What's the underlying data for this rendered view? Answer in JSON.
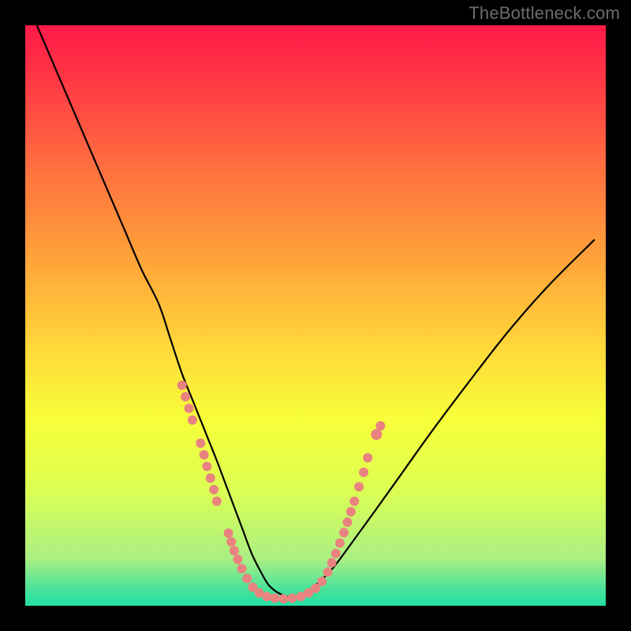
{
  "watermark": "TheBottleneck.com",
  "colors": {
    "curve": "#000000",
    "marker_fill": "#e9837f",
    "marker_stroke": "#e9837f"
  },
  "chart_data": {
    "type": "line",
    "title": "",
    "xlabel": "",
    "ylabel": "",
    "xlim": [
      0,
      100
    ],
    "ylim": [
      0,
      100
    ],
    "grid": false,
    "note": "No axis ticks or numeric labels are rendered; x and y values are estimated fractions (0–100) of the visible plot box. y runs bottom (0) to top (100).",
    "series": [
      {
        "name": "bottleneck-curve",
        "x": [
          2,
          5,
          8,
          11,
          14,
          17,
          20,
          23,
          25,
          27,
          29,
          31,
          33,
          34.5,
          36,
          37.5,
          39,
          40.5,
          42,
          44,
          46,
          48,
          50,
          53,
          56,
          60,
          65,
          70,
          76,
          83,
          90,
          98
        ],
        "y": [
          100,
          93,
          86,
          79,
          72,
          65,
          58,
          52,
          46,
          40,
          35,
          30,
          25,
          21,
          17,
          13,
          9,
          6,
          3.5,
          2,
          1.5,
          2,
          3.5,
          6.5,
          10.5,
          16,
          23,
          30,
          38,
          47,
          55,
          63
        ]
      }
    ],
    "markers": {
      "name": "curve-markers",
      "note": "Coral dot clusters on the curve in the lower region; sizes in pixels.",
      "points": [
        {
          "x": 27.0,
          "y": 38.0,
          "r": 6
        },
        {
          "x": 27.6,
          "y": 36.0,
          "r": 6
        },
        {
          "x": 28.2,
          "y": 34.0,
          "r": 6
        },
        {
          "x": 28.8,
          "y": 32.0,
          "r": 6
        },
        {
          "x": 30.2,
          "y": 28.0,
          "r": 6
        },
        {
          "x": 30.8,
          "y": 26.0,
          "r": 6
        },
        {
          "x": 31.3,
          "y": 24.0,
          "r": 6
        },
        {
          "x": 31.9,
          "y": 22.0,
          "r": 6
        },
        {
          "x": 32.5,
          "y": 20.0,
          "r": 6
        },
        {
          "x": 33.0,
          "y": 18.0,
          "r": 6
        },
        {
          "x": 35.0,
          "y": 12.5,
          "r": 6
        },
        {
          "x": 35.5,
          "y": 11.0,
          "r": 6
        },
        {
          "x": 36.0,
          "y": 9.5,
          "r": 6
        },
        {
          "x": 36.6,
          "y": 8.0,
          "r": 6
        },
        {
          "x": 37.3,
          "y": 6.4,
          "r": 6
        },
        {
          "x": 38.2,
          "y": 4.7,
          "r": 6
        },
        {
          "x": 39.2,
          "y": 3.2,
          "r": 6
        },
        {
          "x": 40.3,
          "y": 2.2,
          "r": 6
        },
        {
          "x": 41.6,
          "y": 1.6,
          "r": 6
        },
        {
          "x": 43.0,
          "y": 1.3,
          "r": 6
        },
        {
          "x": 44.5,
          "y": 1.2,
          "r": 6
        },
        {
          "x": 46.0,
          "y": 1.3,
          "r": 6
        },
        {
          "x": 47.5,
          "y": 1.6,
          "r": 6
        },
        {
          "x": 48.8,
          "y": 2.2,
          "r": 6
        },
        {
          "x": 50.0,
          "y": 3.0,
          "r": 6
        },
        {
          "x": 51.1,
          "y": 4.2,
          "r": 6
        },
        {
          "x": 52.1,
          "y": 5.8,
          "r": 6
        },
        {
          "x": 52.8,
          "y": 7.4,
          "r": 6
        },
        {
          "x": 53.5,
          "y": 9.0,
          "r": 6
        },
        {
          "x": 54.2,
          "y": 10.8,
          "r": 6
        },
        {
          "x": 54.9,
          "y": 12.6,
          "r": 6
        },
        {
          "x": 55.5,
          "y": 14.4,
          "r": 6
        },
        {
          "x": 56.1,
          "y": 16.2,
          "r": 6
        },
        {
          "x": 56.7,
          "y": 18.0,
          "r": 6
        },
        {
          "x": 57.5,
          "y": 20.5,
          "r": 6
        },
        {
          "x": 58.3,
          "y": 23.0,
          "r": 6
        },
        {
          "x": 59.0,
          "y": 25.5,
          "r": 6
        },
        {
          "x": 60.5,
          "y": 29.5,
          "r": 7
        },
        {
          "x": 61.2,
          "y": 31.0,
          "r": 6
        }
      ]
    }
  }
}
